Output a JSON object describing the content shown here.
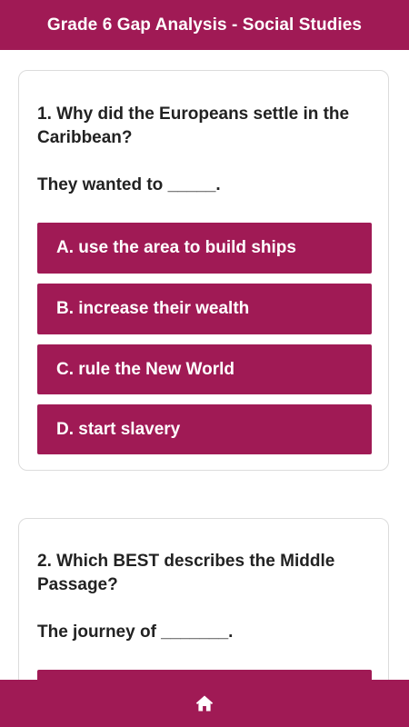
{
  "header": {
    "title": "Grade 6 Gap Analysis - Social Studies"
  },
  "questions": [
    {
      "question": "1. Why did the Europeans settle in the Caribbean?",
      "prompt": "They wanted to _____.",
      "options": [
        "A. use the area to build ships",
        "B. increase their wealth",
        "C. rule the New World",
        "D. start slavery"
      ]
    },
    {
      "question": "2. Which BEST describes the Middle Passage?",
      "prompt": "The journey of _______.",
      "options": [
        ""
      ]
    }
  ],
  "footer": {
    "home_icon": "home-icon"
  },
  "colors": {
    "accent": "#a01a55",
    "card_border": "#dcdcdc",
    "text": "#222222"
  }
}
